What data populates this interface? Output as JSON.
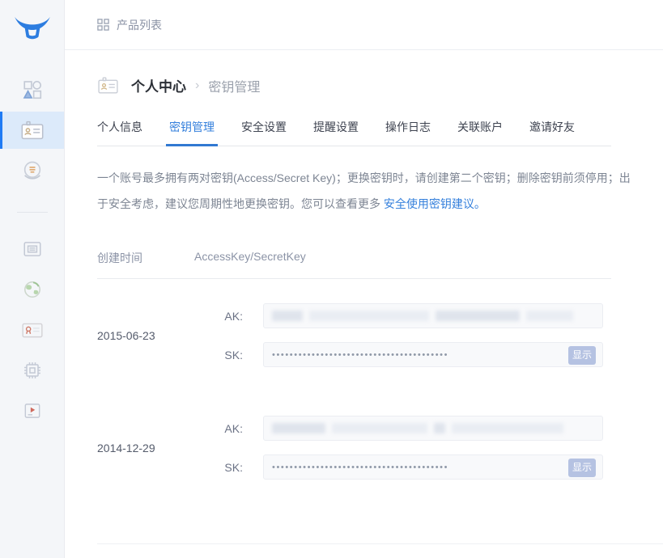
{
  "colors": {
    "accent_blue": "#3580dc",
    "active_nav_bar": "#1f7bf4",
    "active_nav_bg": "#dceafa",
    "sidebar_bg": "#f4f6f9",
    "show_button_bg": "#b5c2e2",
    "logo_blue": "#2d7de0"
  },
  "topbar": {
    "product_list_label": "产品列表"
  },
  "sidebar": {
    "items": [
      {
        "name": "products",
        "icon": "shapes-icon",
        "active": false
      },
      {
        "name": "profile",
        "icon": "id-card-icon",
        "active": true
      },
      {
        "name": "billing",
        "icon": "coin-hand-icon",
        "active": false
      },
      {
        "name": "storage",
        "icon": "folder-icon",
        "active": false
      },
      {
        "name": "network",
        "icon": "globe-icon",
        "active": false
      },
      {
        "name": "certificate",
        "icon": "certificate-icon",
        "active": false
      },
      {
        "name": "compute",
        "icon": "chip-icon",
        "active": false
      },
      {
        "name": "media",
        "icon": "video-player-icon",
        "active": false
      }
    ]
  },
  "breadcrumb": {
    "section": "个人中心",
    "separator": "›",
    "page": "密钥管理"
  },
  "tabs": {
    "items": [
      {
        "label": "个人信息",
        "active": false
      },
      {
        "label": "密钥管理",
        "active": true
      },
      {
        "label": "安全设置",
        "active": false
      },
      {
        "label": "提醒设置",
        "active": false
      },
      {
        "label": "操作日志",
        "active": false
      },
      {
        "label": "关联账户",
        "active": false
      },
      {
        "label": "邀请好友",
        "active": false
      }
    ]
  },
  "description": {
    "text": "一个账号最多拥有两对密钥(Access/Secret Key)；更换密钥时，请创建第二个密钥；删除密钥前须停用；出于安全考虑，建议您周期性地更换密钥。您可以查看更多 ",
    "link_text": "安全使用密钥建议。"
  },
  "table": {
    "columns": [
      "创建时间",
      "AccessKey/SecretKey"
    ],
    "rows": [
      {
        "date": "2015-06-23",
        "ak_label": "AK:",
        "ak_value_state": "redacted",
        "sk_label": "SK:",
        "sk_masked": "••••••••••••••••••••••••••••••••••••••••",
        "show_label": "显示"
      },
      {
        "date": "2014-12-29",
        "ak_label": "AK:",
        "ak_value_state": "redacted",
        "sk_label": "SK:",
        "sk_masked": "••••••••••••••••••••••••••••••••••••••••",
        "show_label": "显示"
      }
    ]
  }
}
